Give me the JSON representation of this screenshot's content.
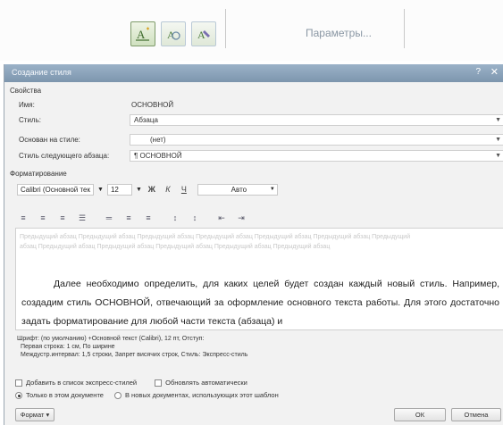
{
  "top": {
    "buttons": [
      "new-style",
      "style-inspector",
      "manage-styles"
    ],
    "params_label": "Параметры..."
  },
  "dialog": {
    "title": "Создание стиля",
    "help": "?",
    "close": "✕",
    "section_properties": "Свойства",
    "name_label": "Имя:",
    "name_value": "ОСНОВНОЙ",
    "style_label": "Стиль:",
    "style_value": "Абзаца",
    "based_label": "Основан на стиле:",
    "based_value": "(нет)",
    "next_label": "Стиль следующего абзаца:",
    "next_value": "¶ ОСНОВНОЙ",
    "section_format": "Форматирование",
    "font_value": "Calibri (Основной тек",
    "size_value": "12",
    "bold": "Ж",
    "italic": "К",
    "underline": "Ч",
    "color_value": "Авто",
    "preview_gray": "Предыдущий абзац Предыдущий абзац Предыдущий абзац Предыдущий абзац Предыдущий абзац Предыдущий абзац Предыдущий абзац Предыдущий абзац Предыдущий абзац Предыдущий абзац Предыдущий абзац Предыдущий абзац",
    "preview_text": "Далее необходимо определить, для каких целей будет создан каждый новый стиль. Например, создадим стиль ОСНОВНОЙ, отвечающий за оформление основного текста работы. Для этого достаточно задать форматирование для любой части текста (абзаца) и",
    "desc_line1": "Шрифт: (по умолчанию) +Основной текст (Calibri), 12 пт, Отступ:",
    "desc_line2": "Первая строка: 1 см, По ширине",
    "desc_line3": "Междустр.интервал: 1,5 строки, Запрет висячих строк, Стиль: Экспресс-стиль",
    "add_quick": "Добавить в список экспресс-стилей",
    "auto_update": "Обновлять автоматически",
    "only_doc": "Только в этом документе",
    "new_docs": "В новых документах, использующих этот шаблон",
    "format_btn": "Формат ▾",
    "ok_btn": "ОК",
    "cancel_btn": "Отмена"
  }
}
